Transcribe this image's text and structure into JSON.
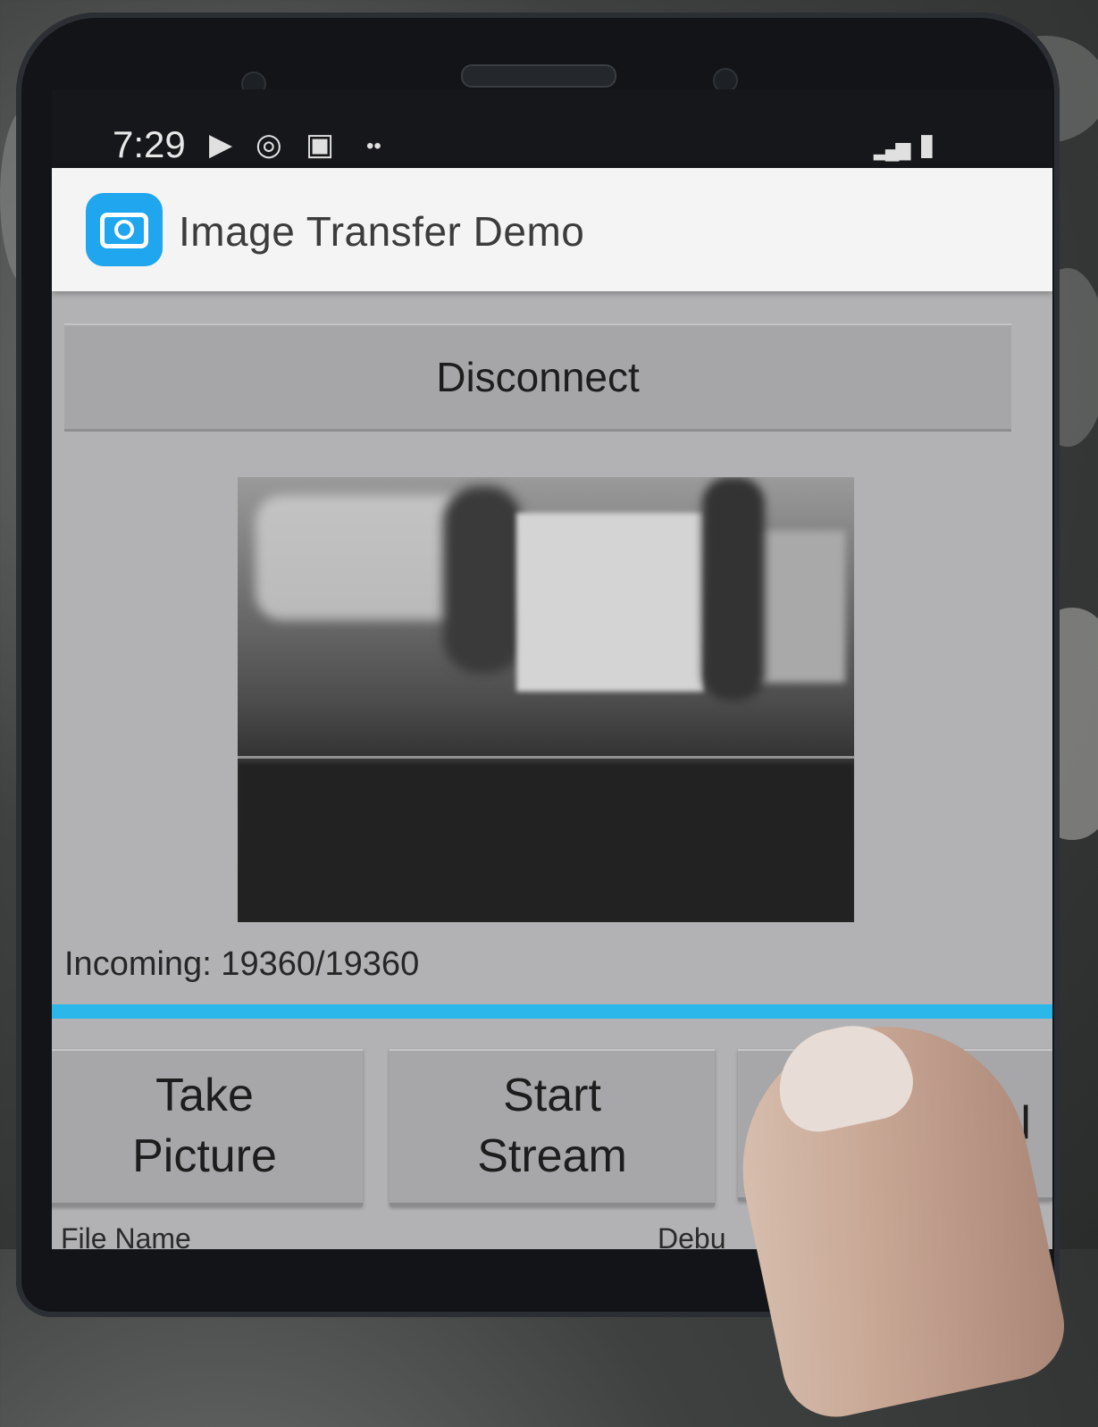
{
  "status_bar": {
    "time": "7:29",
    "icons": [
      "play-store-icon",
      "sync-icon",
      "gallery-icon",
      "more-dots-icon",
      "signal-icon",
      "battery-icon"
    ],
    "play_glyph": "▶",
    "sync_glyph": "◎",
    "gallery_glyph": "▣",
    "dots_glyph": "••",
    "signal_glyph": "▂▄▆",
    "battery_glyph": "▮"
  },
  "app_bar": {
    "title": "Image Transfer Demo",
    "icon": "camera-icon",
    "icon_color": "#1fa6ee"
  },
  "main": {
    "disconnect_label": "Disconnect",
    "preview_image": "camera-preview-image",
    "incoming_text": "Incoming: 19360/19360",
    "progress": 1.0,
    "progress_color": "#2bb7ea",
    "buttons": [
      {
        "line1": "Take",
        "line2": "Picture"
      },
      {
        "line1": "Start",
        "line2": "Stream"
      },
      {
        "line1": "",
        "line2": "cel"
      }
    ],
    "footer_left": "File Name",
    "footer_right": "Debu"
  }
}
